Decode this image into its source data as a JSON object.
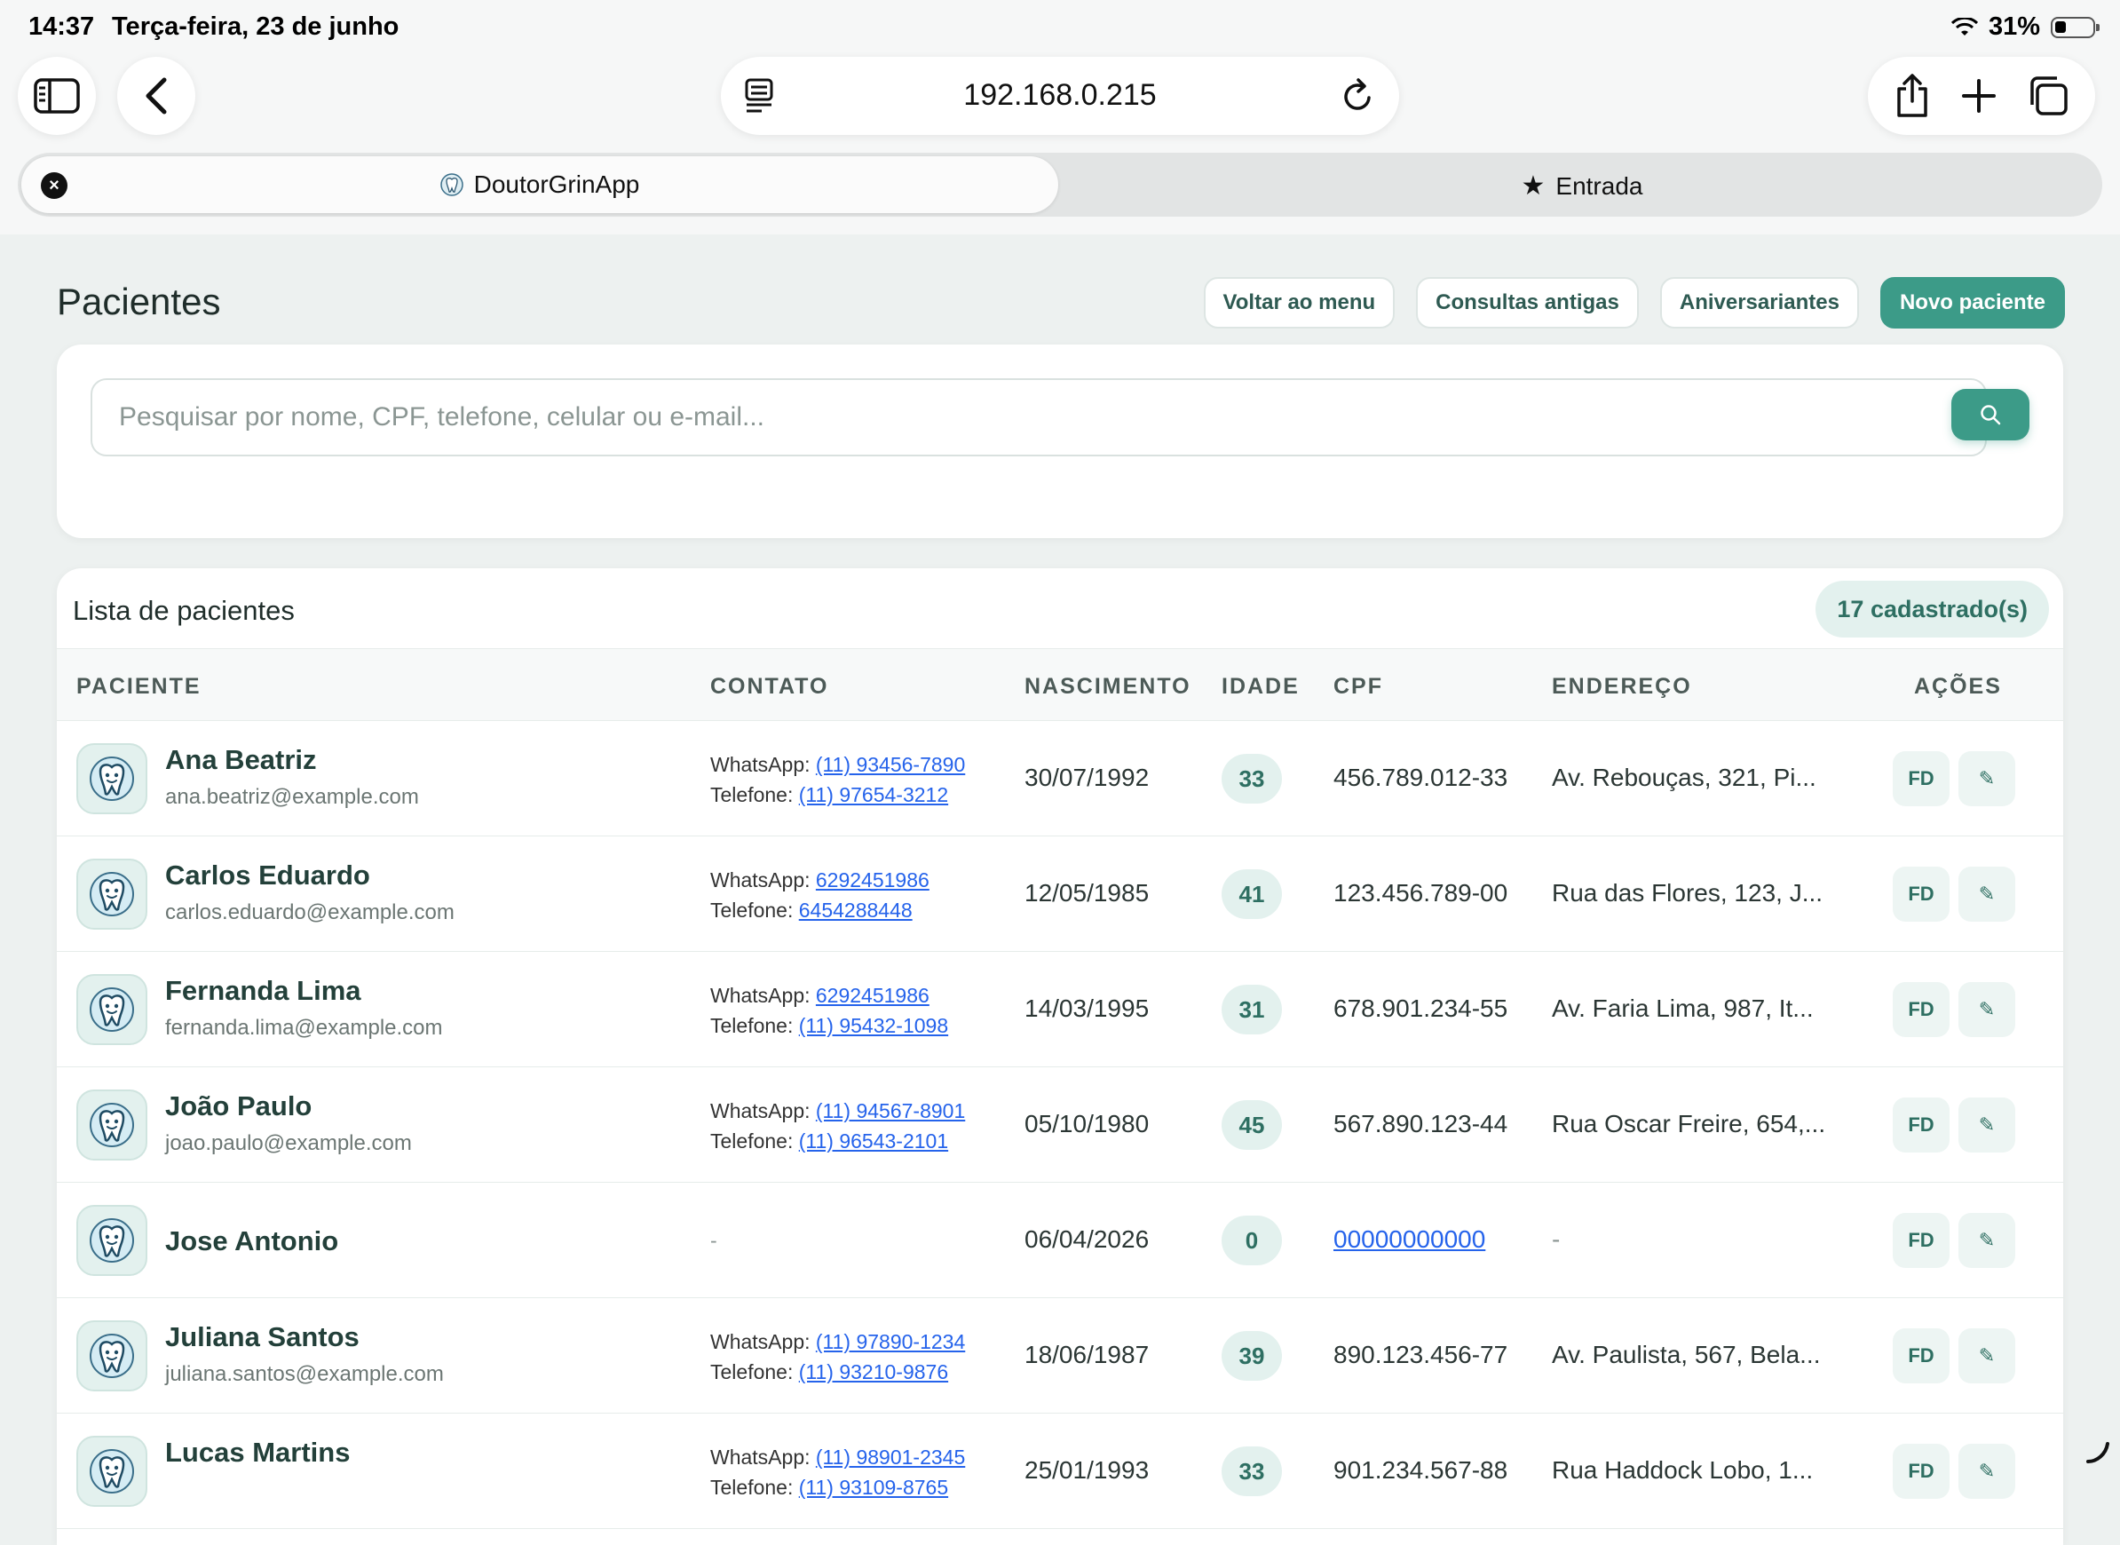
{
  "status_bar": {
    "time": "14:37",
    "date": "Terça-feira, 23 de junho",
    "battery": "31%"
  },
  "browser": {
    "url": "192.168.0.215",
    "tabs": [
      {
        "label": "DoutorGrinApp",
        "active": true
      },
      {
        "label": "Entrada",
        "active": false
      }
    ]
  },
  "page": {
    "title": "Pacientes",
    "buttons": {
      "back_menu": "Voltar ao menu",
      "old_consults": "Consultas antigas",
      "birthdays": "Aniversariantes",
      "new_patient": "Novo paciente"
    },
    "search": {
      "placeholder": "Pesquisar por nome, CPF, telefone, celular ou e-mail...",
      "value": ""
    },
    "list": {
      "title": "Lista de pacientes",
      "count": "17 cadastrado(s)",
      "headers": {
        "patient": "PACIENTE",
        "contact": "CONTATO",
        "birth": "NASCIMENTO",
        "age": "IDADE",
        "cpf": "CPF",
        "address": "ENDEREÇO",
        "actions": "AÇÕES"
      },
      "whatsapp_label": "WhatsApp:",
      "phone_label": "Telefone:",
      "action_fd": "FD",
      "action_edit": "✎",
      "rows": [
        {
          "name": "Ana Beatriz",
          "email": "ana.beatriz@example.com",
          "whatsapp": "(11) 93456-7890",
          "phone": "(11) 97654-3212",
          "birth": "30/07/1992",
          "age": "33",
          "cpf": "456.789.012-33",
          "address": "Av. Rebouças, 321, Pi..."
        },
        {
          "name": "Carlos Eduardo",
          "email": "carlos.eduardo@example.com",
          "whatsapp": "6292451986",
          "phone": "6454288448",
          "birth": "12/05/1985",
          "age": "41",
          "cpf": "123.456.789-00",
          "address": "Rua das Flores, 123, J..."
        },
        {
          "name": "Fernanda Lima",
          "email": "fernanda.lima@example.com",
          "whatsapp": "6292451986",
          "phone": "(11) 95432-1098",
          "birth": "14/03/1995",
          "age": "31",
          "cpf": "678.901.234-55",
          "address": "Av. Faria Lima, 987, It..."
        },
        {
          "name": "João Paulo",
          "email": "joao.paulo@example.com",
          "whatsapp": "(11) 94567-8901",
          "phone": "(11) 96543-2101",
          "birth": "05/10/1980",
          "age": "45",
          "cpf": "567.890.123-44",
          "address": "Rua Oscar Freire, 654,..."
        },
        {
          "name": "Jose Antonio",
          "email": "",
          "contact_dash": "-",
          "birth": "06/04/2026",
          "age": "0",
          "cpf": "00000000000",
          "address": "-"
        },
        {
          "name": "Juliana Santos",
          "email": "juliana.santos@example.com",
          "whatsapp": "(11) 97890-1234",
          "phone": "(11) 93210-9876",
          "birth": "18/06/1987",
          "age": "39",
          "cpf": "890.123.456-77",
          "address": "Av. Paulista, 567, Bela..."
        },
        {
          "name": "Lucas Martins",
          "email": "",
          "whatsapp": "(11) 98901-2345",
          "phone": "(11) 93109-8765",
          "birth": "25/01/1993",
          "age": "33",
          "cpf": "901.234.567-88",
          "address": "Rua Haddock Lobo, 1..."
        }
      ]
    }
  },
  "colors": {
    "accent": "#3c9b88",
    "accent_light": "#e3f1ee",
    "link": "#2563eb",
    "page_bg": "#edf1f0"
  }
}
